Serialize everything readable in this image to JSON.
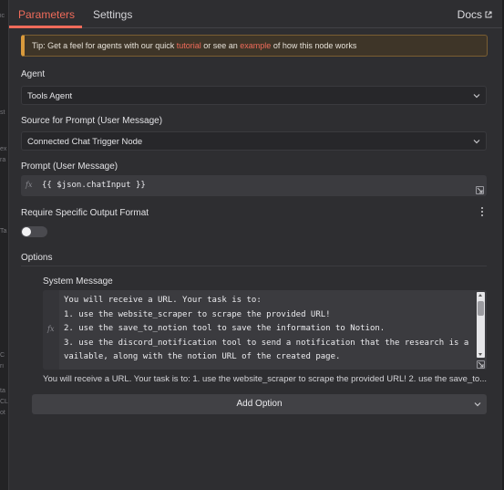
{
  "left_rail": {
    "fragments": [
      "ic",
      "st",
      "ex",
      "ra",
      "Ta",
      "C",
      "ri",
      "ta",
      "CL",
      "ot"
    ]
  },
  "tabs": [
    {
      "label": "Parameters",
      "active": true
    },
    {
      "label": "Settings",
      "active": false
    }
  ],
  "docs": {
    "label": "Docs",
    "icon": "external-link-icon"
  },
  "tip": {
    "prefix": "Tip: Get a feel for agents with our quick ",
    "link1": "tutorial",
    "middle": " or see an ",
    "link2": "example",
    "suffix": " of how this node works"
  },
  "agent": {
    "label": "Agent",
    "value": "Tools Agent"
  },
  "source": {
    "label": "Source for Prompt (User Message)",
    "value": "Connected Chat Trigger Node"
  },
  "prompt": {
    "label": "Prompt (User Message)",
    "fx": "fx",
    "value": "{{ $json.chatInput }}"
  },
  "output_format": {
    "label": "Require Specific Output Format",
    "enabled": false
  },
  "options": {
    "label": "Options",
    "system_message": {
      "label": "System Message",
      "fx": "fx",
      "text": "You will receive a URL. Your task is to:\n1. use the website_scraper to scrape the provided URL!\n2. use the save_to_notion tool to save the information to Notion.\n3. use the discord_notification tool to send a notification that the research is available, along with the notion URL of the created page.",
      "preview": "You will receive a URL. Your task is to: 1. use the website_scraper to scrape the provided URL! 2. use the save_to..."
    },
    "add_option_label": "Add Option"
  },
  "colors": {
    "accent": "#f06b5a",
    "background": "#2e2e31",
    "tip_border": "#d99a3c"
  }
}
